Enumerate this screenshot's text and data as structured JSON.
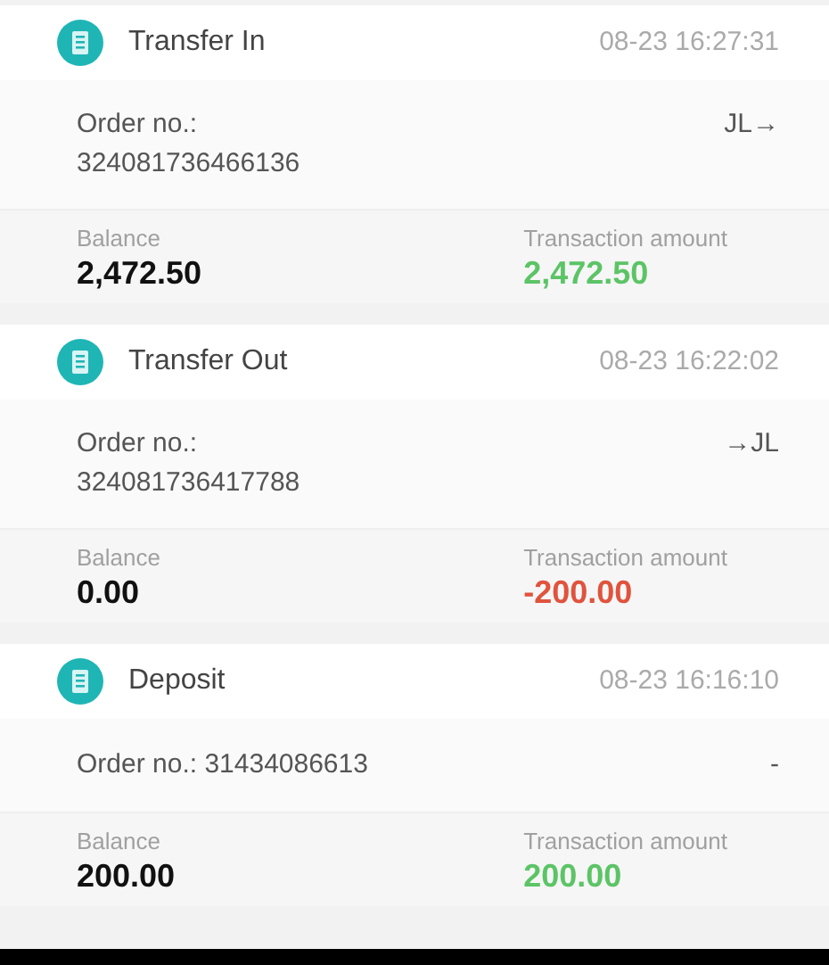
{
  "transactions": [
    {
      "type": "Transfer In",
      "time": "08-23 16:27:31",
      "kind": "stacked",
      "order_label": "Order no.:",
      "order_no": "324081736466136",
      "counterparty": "JL→",
      "balance_label": "Balance",
      "balance": "2,472.50",
      "amount_label": "Transaction amount",
      "amount": "2,472.50",
      "color": "#5cc466"
    },
    {
      "type": "Transfer Out",
      "time": "08-23 16:22:02",
      "kind": "stacked",
      "order_label": "Order no.:",
      "order_no": "324081736417788",
      "counterparty": "→JL",
      "balance_label": "Balance",
      "balance": "0.00",
      "amount_label": "Transaction amount",
      "amount": "-200.00",
      "color": "#e0533d"
    },
    {
      "type": "Deposit",
      "time": "08-23 16:16:10",
      "kind": "inline",
      "order_label": "Order no.:",
      "order_no": "31434086613",
      "counterparty": "-",
      "balance_label": "Balance",
      "balance": "200.00",
      "amount_label": "Transaction amount",
      "amount": "200.00",
      "color": "#5cc466"
    }
  ]
}
